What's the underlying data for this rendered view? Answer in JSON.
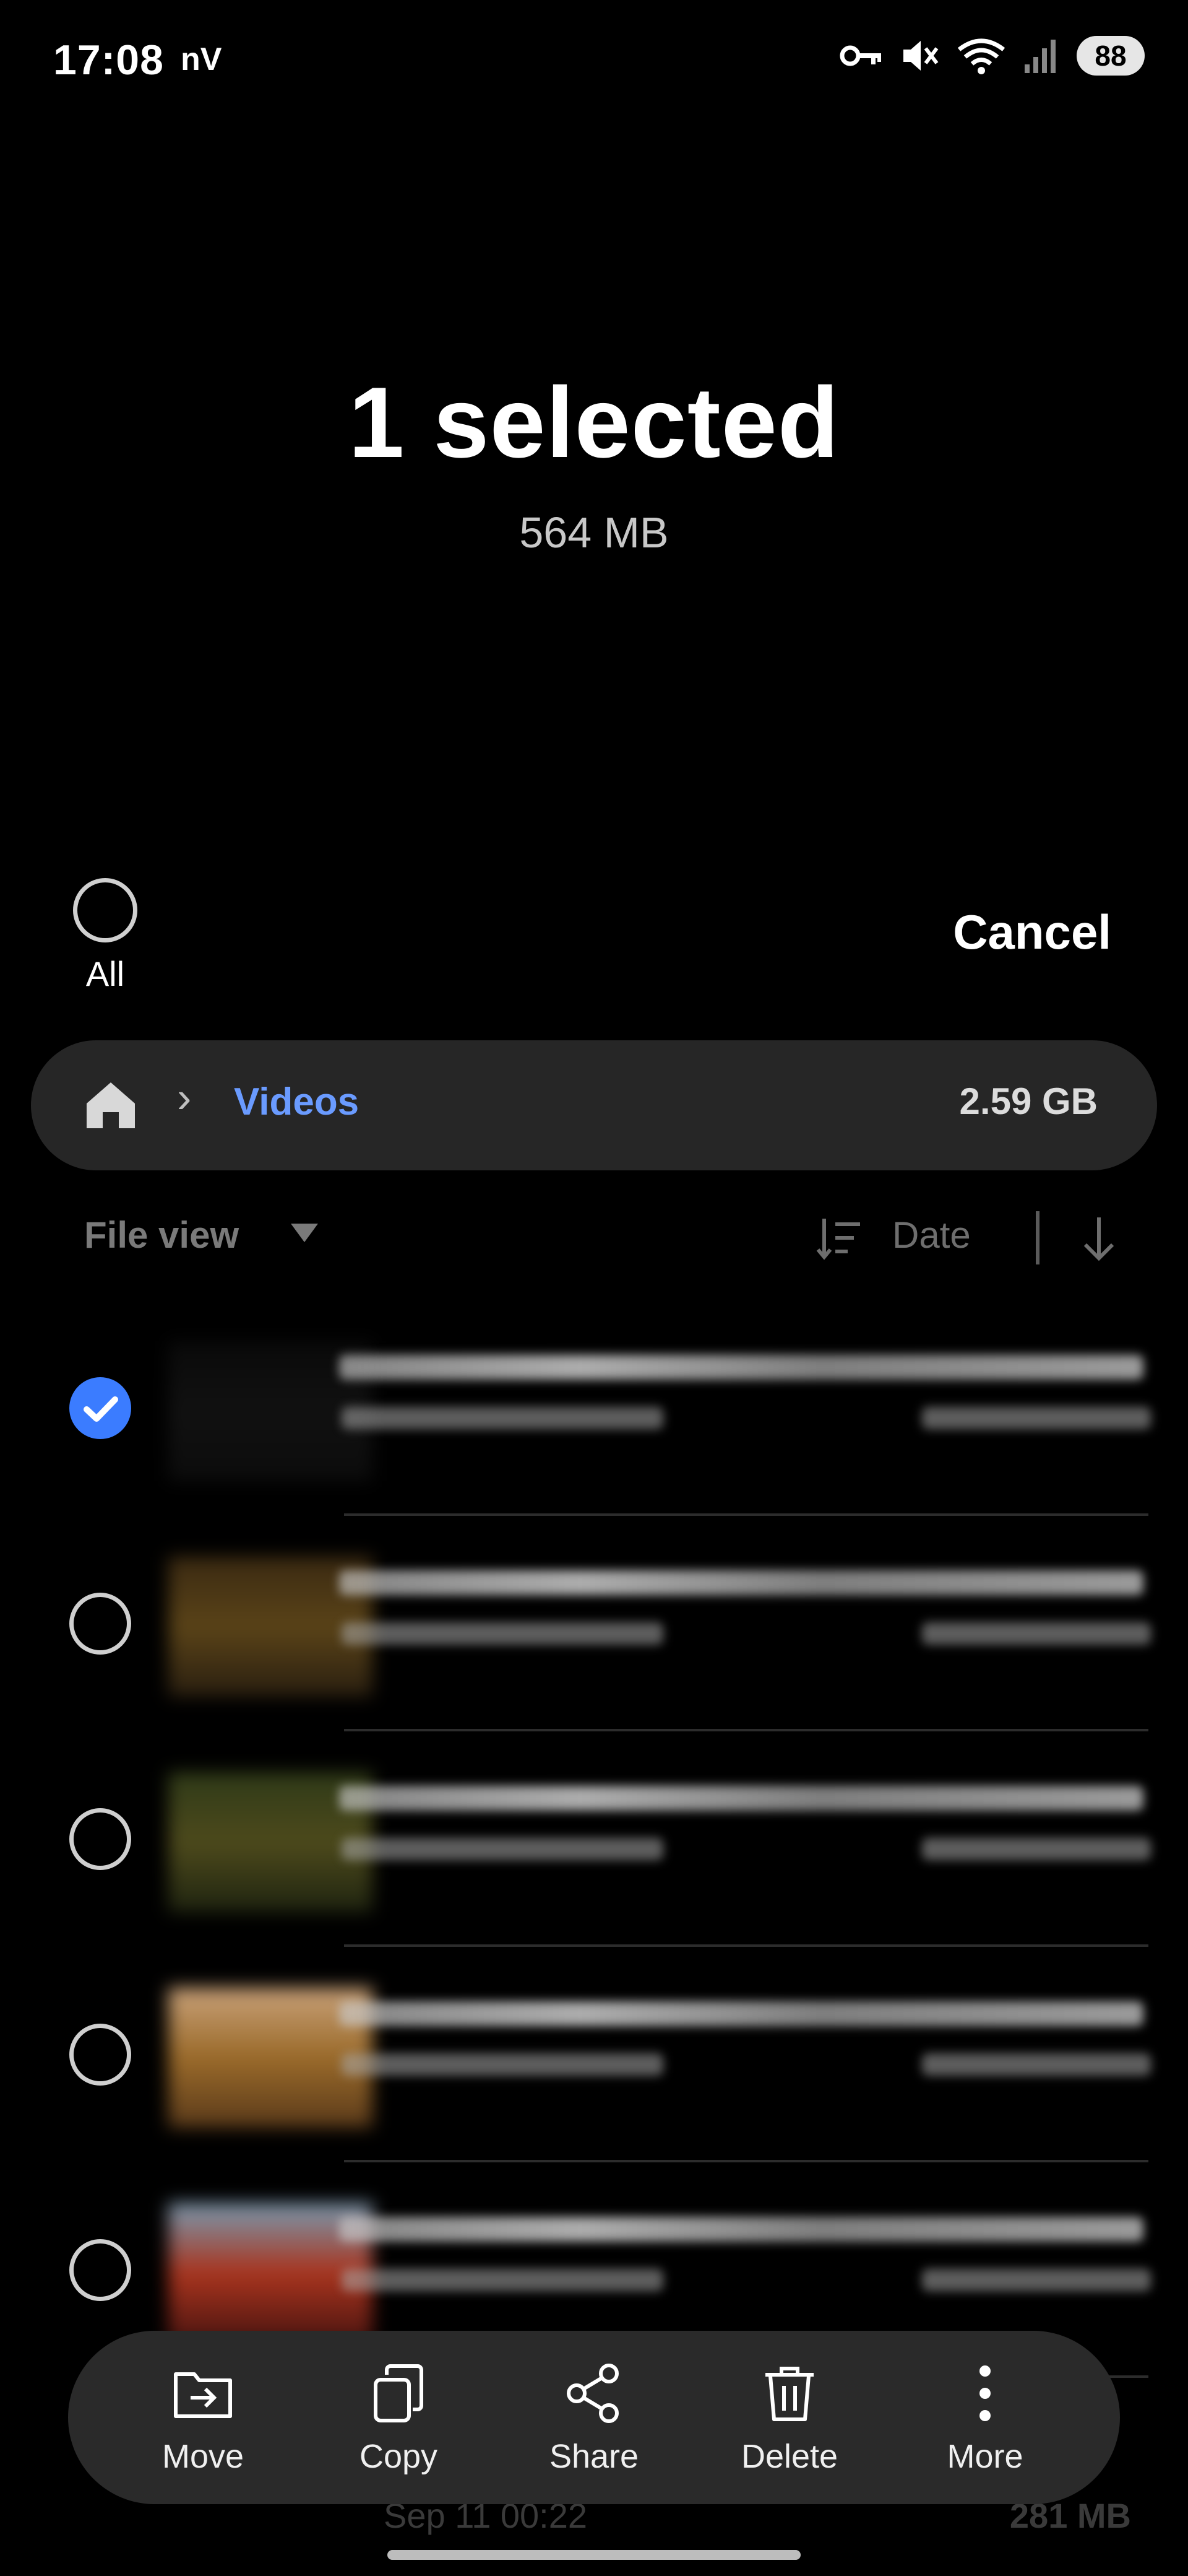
{
  "status_bar": {
    "time": "17:08",
    "carrier": "nV",
    "battery": "88"
  },
  "header": {
    "title": "1 selected",
    "subtitle": "564 MB"
  },
  "select_all": {
    "label": "All"
  },
  "cancel_label": "Cancel",
  "path_bar": {
    "folder": "Videos",
    "size": "2.59 GB"
  },
  "toolbar": {
    "view_label": "File view",
    "sort_label": "Date"
  },
  "files": [
    {
      "selected": true,
      "thumb": [
        "#0a0a0a",
        "#111111",
        "#0c0c0c"
      ]
    },
    {
      "selected": false,
      "thumb": [
        "#3b2a12",
        "#5a4318",
        "#2a1f10"
      ]
    },
    {
      "selected": false,
      "thumb": [
        "#2f3a18",
        "#4d4a1c",
        "#1f2410"
      ]
    },
    {
      "selected": false,
      "thumb": [
        "#c9a27a",
        "#9a6a2a",
        "#5a3a1a"
      ]
    },
    {
      "selected": false,
      "thumb": [
        "#7a9ab0",
        "#a8341e",
        "#4a1410"
      ]
    }
  ],
  "peek_row": {
    "name": "Sep 11 00:22",
    "size": "281 MB"
  },
  "actions": [
    {
      "label": "Move",
      "icon": "move-icon"
    },
    {
      "label": "Copy",
      "icon": "copy-icon"
    },
    {
      "label": "Share",
      "icon": "share-icon"
    },
    {
      "label": "Delete",
      "icon": "delete-icon"
    },
    {
      "label": "More",
      "icon": "more-icon"
    }
  ],
  "colors": {
    "accent": "#3b7cff",
    "folder_link": "#6a9bff",
    "background": "#000000",
    "bar": "#2a2a2a"
  }
}
